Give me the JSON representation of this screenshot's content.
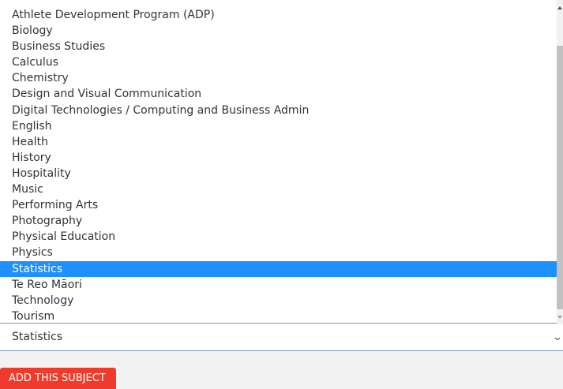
{
  "subject_select": {
    "options": [
      "Athlete Development Program (ADP)",
      "Biology",
      "Business Studies",
      "Calculus",
      "Chemistry",
      "Design and Visual Communication",
      "Digital Technologies / Computing and Business Admin",
      "English",
      "Health",
      "History",
      "Hospitality",
      "Music",
      "Performing Arts",
      "Photography",
      "Physical Education",
      "Physics",
      "Statistics",
      "Te Reo Māori",
      "Technology",
      "Tourism"
    ],
    "selected_index": 16,
    "selected_value": "Statistics",
    "chevron_icon": "chevron-down-icon"
  },
  "add_button": {
    "label": "ADD THIS SUBJECT"
  },
  "colors": {
    "selected_highlight": "#1e90ff",
    "button_red": "#f03a2c",
    "page_background": "#f2f2f2"
  }
}
